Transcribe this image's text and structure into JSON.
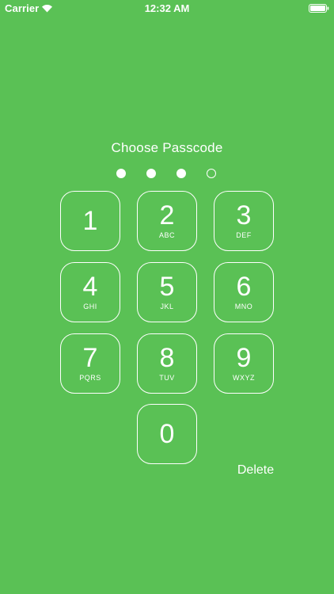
{
  "status_bar": {
    "carrier": "Carrier",
    "time": "12:32 AM",
    "wifi_icon": "wifi-icon",
    "battery_icon": "battery-icon"
  },
  "passcode": {
    "prompt": "Choose Passcode",
    "total_digits": 4,
    "entered_digits": 3
  },
  "keypad": {
    "keys": [
      {
        "digit": "1",
        "letters": ""
      },
      {
        "digit": "2",
        "letters": "ABC"
      },
      {
        "digit": "3",
        "letters": "DEF"
      },
      {
        "digit": "4",
        "letters": "GHI"
      },
      {
        "digit": "5",
        "letters": "JKL"
      },
      {
        "digit": "6",
        "letters": "MNO"
      },
      {
        "digit": "7",
        "letters": "PQRS"
      },
      {
        "digit": "8",
        "letters": "TUV"
      },
      {
        "digit": "9",
        "letters": "WXYZ"
      },
      {
        "digit": "0",
        "letters": ""
      }
    ],
    "delete_label": "Delete"
  },
  "colors": {
    "background": "#5ac155",
    "foreground": "#ffffff"
  }
}
